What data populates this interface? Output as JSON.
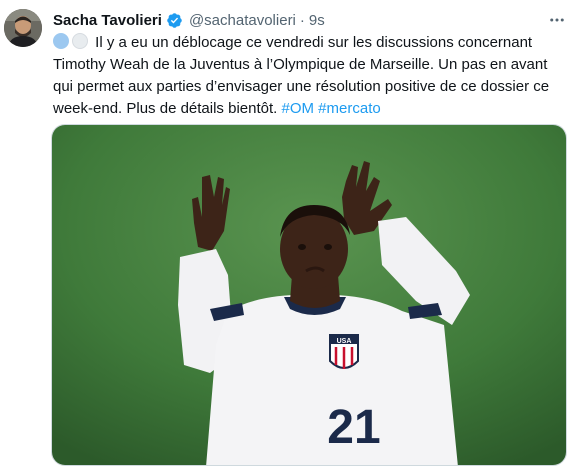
{
  "author": {
    "name": "Sacha Tavolieri",
    "handle": "@sachatavolieri",
    "separator": "·",
    "time": "9s",
    "verified_icon": "verified-badge-icon",
    "avatar_icon": "avatar"
  },
  "tweet": {
    "line_1": "Il y a eu un déblocage ce vendredi sur les discussions concernant",
    "line_2": "Timothy Weah de la Juventus à l’Olympique de Marseille. Un pas en avant",
    "line_3": "qui permet aux parties d’envisager une résolution positive de ce dossier ce",
    "line_4_text": "week-end. Plus de détails bientôt.",
    "hashtag_1": "#OM",
    "hashtag_2": "#mercato"
  },
  "media": {
    "jersey_number": "21",
    "badge_text": "USA"
  },
  "colors": {
    "accent": "#1d9bf0",
    "pitch": "#3f7a3a",
    "secondary_text": "#536471"
  }
}
